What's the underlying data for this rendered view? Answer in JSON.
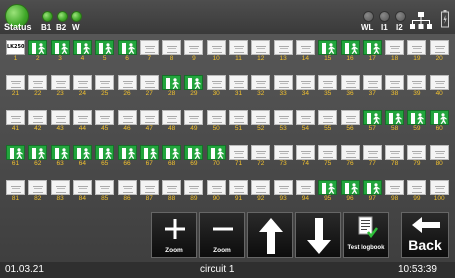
{
  "topbar": {
    "status_label": "Status",
    "indicators_left": [
      "B1",
      "B2",
      "W"
    ],
    "indicators_right": [
      "WL",
      "I1",
      "I2"
    ],
    "network_icon": "network-icon",
    "battery_icon": "battery-icon"
  },
  "colors": {
    "active": "#22a53d",
    "label_yellow": "#f2c12e"
  },
  "grid": {
    "first_tile_label": "LK250",
    "active": [
      2,
      3,
      4,
      5,
      6,
      15,
      16,
      17,
      28,
      29,
      57,
      58,
      59,
      60,
      61,
      62,
      63,
      64,
      65,
      66,
      67,
      68,
      69,
      70,
      95,
      96,
      97
    ],
    "labels": [
      "1",
      "2",
      "3",
      "4",
      "5",
      "6",
      "7",
      "8",
      "9",
      "10",
      "11",
      "12",
      "13",
      "14",
      "15",
      "16",
      "17",
      "18",
      "19",
      "20",
      "21",
      "22",
      "23",
      "24",
      "25",
      "26",
      "27",
      "28",
      "29",
      "30",
      "31",
      "32",
      "33",
      "34",
      "35",
      "36",
      "37",
      "38",
      "39",
      "40",
      "41",
      "42",
      "43",
      "44",
      "45",
      "46",
      "47",
      "48",
      "49",
      "50",
      "51",
      "52",
      "53",
      "54",
      "55",
      "56",
      "57",
      "58",
      "59",
      "60",
      "61",
      "62",
      "63",
      "64",
      "65",
      "66",
      "67",
      "68",
      "69",
      "70",
      "71",
      "72",
      "73",
      "74",
      "75",
      "76",
      "77",
      "78",
      "79",
      "80",
      "81",
      "82",
      "83",
      "84",
      "85",
      "86",
      "87",
      "88",
      "89",
      "90",
      "91",
      "92",
      "93",
      "94",
      "95",
      "96",
      "97",
      "98",
      "99",
      "100"
    ]
  },
  "buttons": {
    "zoom_in": "Zoom",
    "zoom_out": "Zoom",
    "test_logbook": "Test logbook",
    "back": "Back"
  },
  "footer": {
    "date": "01.03.21",
    "circuit": "circuit 1",
    "time": "10:53:39"
  }
}
